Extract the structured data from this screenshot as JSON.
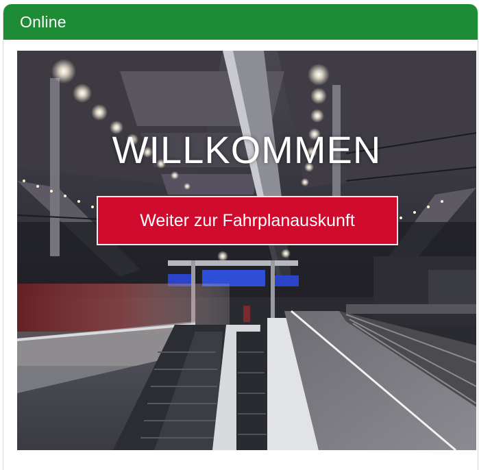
{
  "panel": {
    "title": "Online",
    "header_color": "#1e8b35"
  },
  "hero": {
    "welcome_text": "WILLKOMMEN",
    "cta_label": "Weiter zur Fahrplanauskunft",
    "cta_color": "#cf0a2c"
  }
}
